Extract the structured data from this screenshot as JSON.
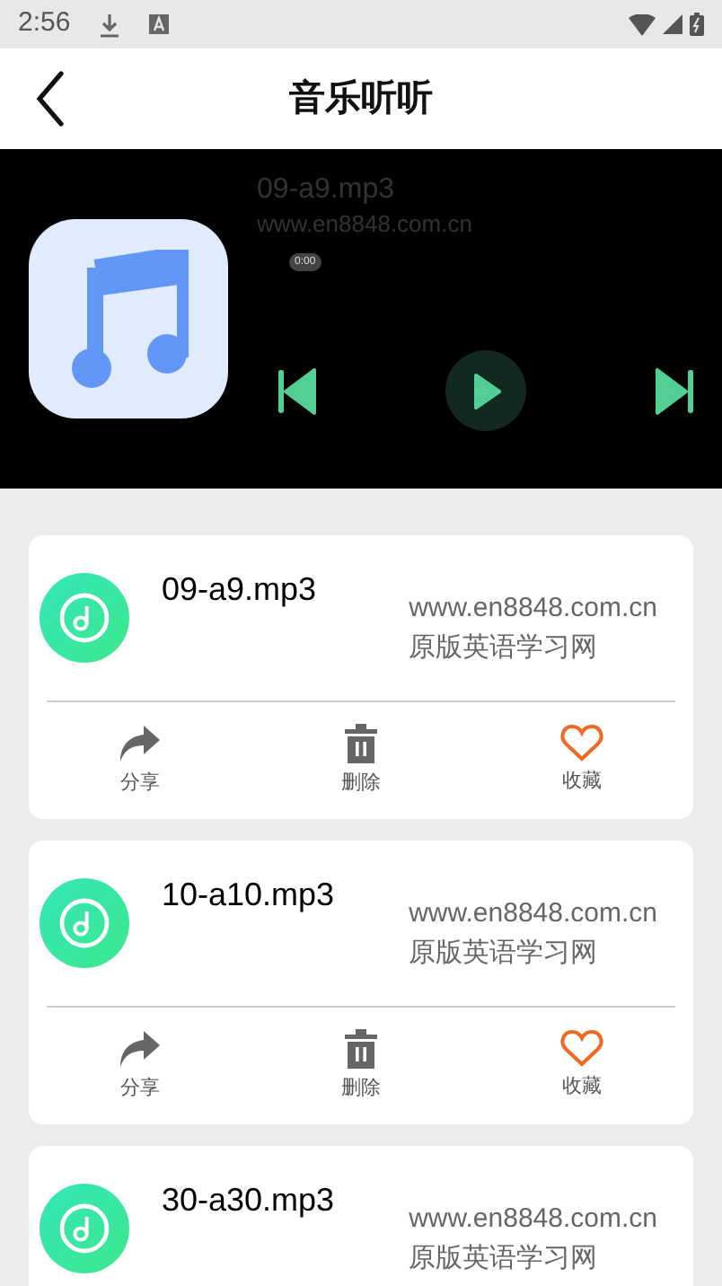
{
  "status_bar": {
    "time": "2:56"
  },
  "header": {
    "title": "音乐听听"
  },
  "player": {
    "title": "09-a9.mp3",
    "subtitle": "www.en8848.com.cn",
    "time": "0:00",
    "playing": false
  },
  "tracks": [
    {
      "title": "09-a9.mp3",
      "site": "www.en8848.com.cn",
      "source": "原版英语学习网",
      "actions": [
        {
          "kind": "share",
          "label": "分享"
        },
        {
          "kind": "delete",
          "label": "删除"
        },
        {
          "kind": "favorite",
          "label": "收藏"
        }
      ]
    },
    {
      "title": "10-a10.mp3",
      "site": "www.en8848.com.cn",
      "source": "原版英语学习网",
      "actions": [
        {
          "kind": "share",
          "label": "分享"
        },
        {
          "kind": "delete",
          "label": "删除"
        },
        {
          "kind": "favorite",
          "label": "收藏"
        }
      ]
    },
    {
      "title": "30-a30.mp3",
      "site": "www.en8848.com.cn",
      "source": "原版英语学习网"
    }
  ]
}
